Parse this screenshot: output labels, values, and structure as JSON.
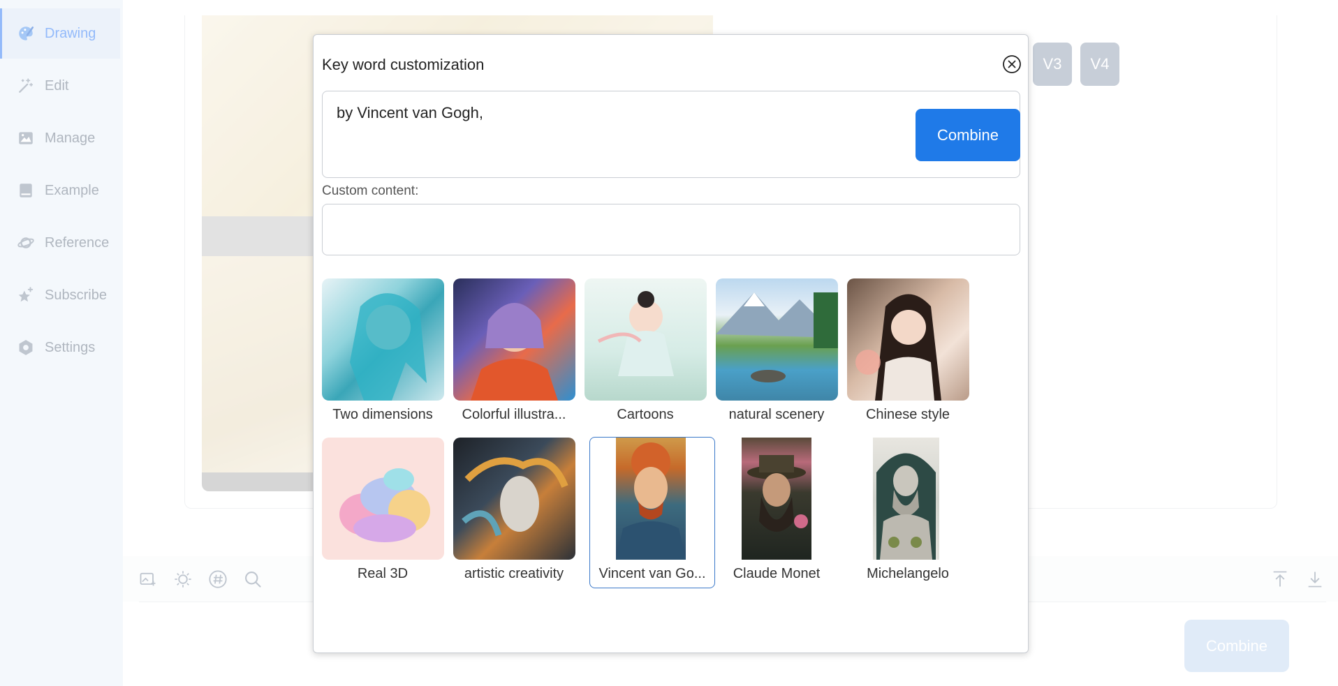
{
  "sidebar": {
    "items": [
      {
        "label": "Drawing",
        "icon": "palette-icon",
        "active": true
      },
      {
        "label": "Edit",
        "icon": "magic-wand-icon"
      },
      {
        "label": "Manage",
        "icon": "image-icon"
      },
      {
        "label": "Example",
        "icon": "book-icon"
      },
      {
        "label": "Reference",
        "icon": "planet-icon"
      },
      {
        "label": "Subscribe",
        "icon": "star-sparkle-icon"
      },
      {
        "label": "Settings",
        "icon": "gear-icon"
      }
    ]
  },
  "main": {
    "variation_buttons": [
      "V3",
      "V4"
    ]
  },
  "toolbar": {
    "icons": [
      "image-text-icon",
      "sun-icon",
      "hashtag-icon",
      "search-icon",
      "upload-icon",
      "download-icon"
    ],
    "combine_label": "Combine"
  },
  "modal": {
    "title": "Key word customization",
    "keyword_text": "by Vincent van Gogh,",
    "combine_label": "Combine",
    "custom_label": "Custom content:",
    "custom_value": "",
    "styles": [
      {
        "label": "Two dimensions",
        "selected": false
      },
      {
        "label": "Colorful illustra...",
        "selected": false
      },
      {
        "label": "Cartoons",
        "selected": false
      },
      {
        "label": "natural scenery",
        "selected": false
      },
      {
        "label": "Chinese style",
        "selected": false
      },
      {
        "label": "Real 3D",
        "selected": false
      },
      {
        "label": "artistic creativity",
        "selected": false
      },
      {
        "label": "Vincent van Go...",
        "selected": true
      },
      {
        "label": "Claude Monet",
        "selected": false
      },
      {
        "label": "Michelangelo",
        "selected": false
      }
    ]
  },
  "colors": {
    "accent": "#1f7ae8",
    "sidebar_bg": "#ebf2fa",
    "selected_border": "#3a78c9"
  }
}
